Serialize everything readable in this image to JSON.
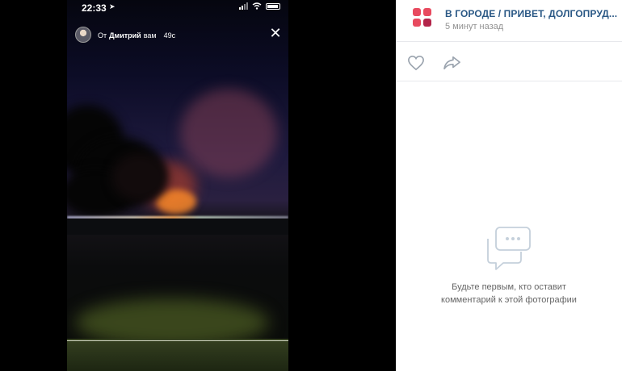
{
  "status_bar": {
    "time": "22:33",
    "location_arrow": "location-arrow-icon"
  },
  "story": {
    "from_prefix": "От",
    "author": "Дмитрий",
    "to": "вам",
    "age": "49с",
    "close_icon": "close-icon"
  },
  "post": {
    "group_name": "В ГОРОДЕ / ПРИВЕТ, ДОЛГОПРУД...",
    "time": "5 минут назад",
    "logo_colors": [
      "#e84a5f",
      "#e84a5f",
      "#e84a5f",
      "#b3254a"
    ],
    "like_icon": "heart-icon",
    "share_icon": "share-icon"
  },
  "comments": {
    "empty_line1": "Будьте первым, кто оставит",
    "empty_line2": "комментарий к этой фотографии",
    "icon": "comment-bubble-icon"
  },
  "colors": {
    "link": "#2a5885",
    "muted": "#939393",
    "text": "#656565",
    "icon": "#99a2ad"
  }
}
